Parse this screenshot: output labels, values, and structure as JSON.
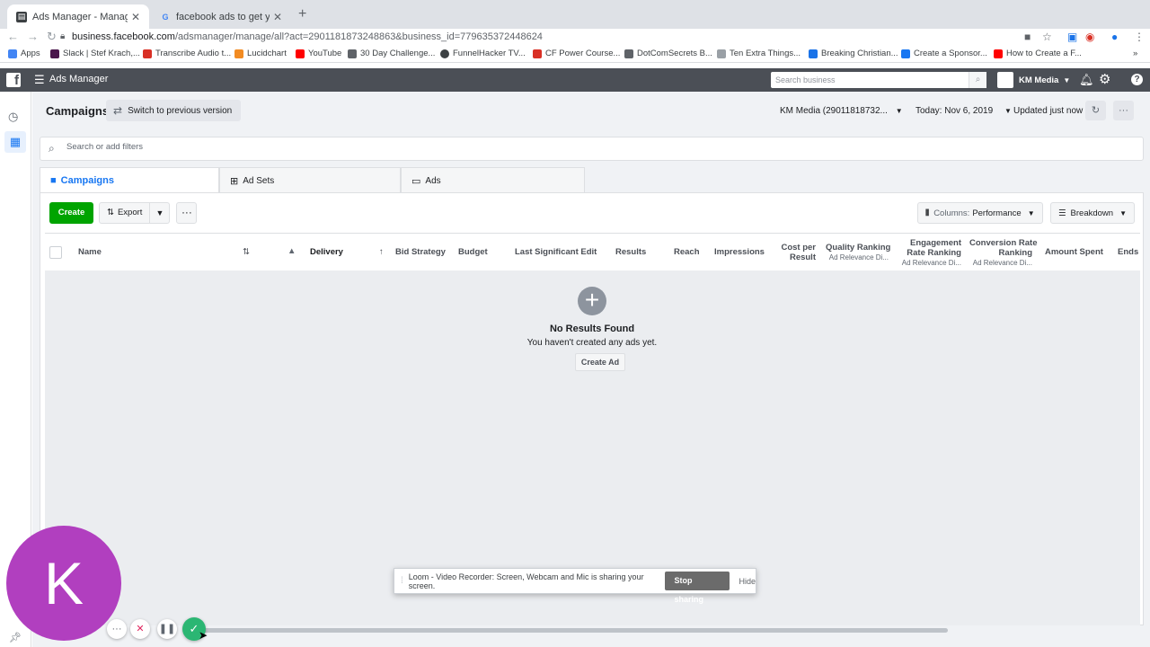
{
  "browser": {
    "tabs": [
      {
        "title": "Ads Manager - Manage Ads",
        "favicon": "facebook-page-icon",
        "active": true
      },
      {
        "title": "facebook ads to get youtube s",
        "favicon": "google-icon",
        "active": false
      }
    ],
    "url_domain": "business.facebook.com",
    "url_path": "/adsmanager/manage/all?act=2901181873248863&business_id=779635372448624",
    "bookmarks": [
      {
        "label": "Apps",
        "color": "#4285f4"
      },
      {
        "label": "Slack | Stef Krach,...",
        "color": "#4a154b"
      },
      {
        "label": "Transcribe Audio t...",
        "color": "#d93025"
      },
      {
        "label": "Lucidchart",
        "color": "#f28b22"
      },
      {
        "label": "YouTube",
        "color": "#ff0000"
      },
      {
        "label": "30 Day Challenge...",
        "color": "#5f6368"
      },
      {
        "label": "FunnelHacker TV...",
        "color": "#3c4043"
      },
      {
        "label": "CF Power Course...",
        "color": "#d93025"
      },
      {
        "label": "DotComSecrets B...",
        "color": "#5f6368"
      },
      {
        "label": "Ten Extra Things...",
        "color": "#9aa0a6"
      },
      {
        "label": "Breaking Christian...",
        "color": "#1a73e8"
      },
      {
        "label": "Create a Sponsor...",
        "color": "#1877f2"
      },
      {
        "label": "How to Create a F...",
        "color": "#ff0000"
      }
    ]
  },
  "fb": {
    "app_title": "Ads Manager",
    "search_placeholder": "Search business",
    "account_name": "KM Media"
  },
  "header": {
    "title": "Campaigns",
    "switch_label": "Switch to previous version",
    "account_selector": "KM Media (29011818732...",
    "date_selector": "Today: Nov 6, 2019",
    "updated": "Updated just now"
  },
  "filter": {
    "placeholder": "Search or add filters"
  },
  "level_tabs": [
    {
      "label": "Campaigns",
      "icon": "folder-icon"
    },
    {
      "label": "Ad Sets",
      "icon": "grid-icon"
    },
    {
      "label": "Ads",
      "icon": "ad-icon"
    }
  ],
  "toolbar": {
    "create": "Create",
    "export": "Export",
    "columns_prefix": "Columns:",
    "columns_value": "Performance",
    "breakdown": "Breakdown"
  },
  "table": {
    "columns": [
      {
        "label": "Name"
      },
      {
        "label": "Delivery"
      },
      {
        "label": "Bid Strategy"
      },
      {
        "label": "Budget"
      },
      {
        "label": "Last Significant Edit"
      },
      {
        "label": "Results"
      },
      {
        "label": "Reach"
      },
      {
        "label": "Impressions"
      },
      {
        "label": "Cost per",
        "label2": "Result"
      },
      {
        "label": "Quality Ranking",
        "sub": "Ad Relevance Di..."
      },
      {
        "label": "Engagement",
        "label2": "Rate Ranking",
        "sub": "Ad Relevance Di..."
      },
      {
        "label": "Conversion Rate",
        "label2": "Ranking",
        "sub": "Ad Relevance Di..."
      },
      {
        "label": "Amount Spent"
      },
      {
        "label": "Ends"
      }
    ],
    "empty_title": "No Results Found",
    "empty_subtitle": "You haven't created any ads yet.",
    "empty_button": "Create Ad"
  },
  "loom": {
    "avatar_letter": "K",
    "banner_text": "Loom - Video Recorder: Screen, Webcam and Mic is sharing your screen.",
    "stop_label": "Stop sharing",
    "hide_label": "Hide"
  },
  "colors": {
    "create_green": "#00a400",
    "fb_bar": "#4b4f56",
    "accent_blue": "#1877f2",
    "loom_purple": "#b13fbf"
  }
}
